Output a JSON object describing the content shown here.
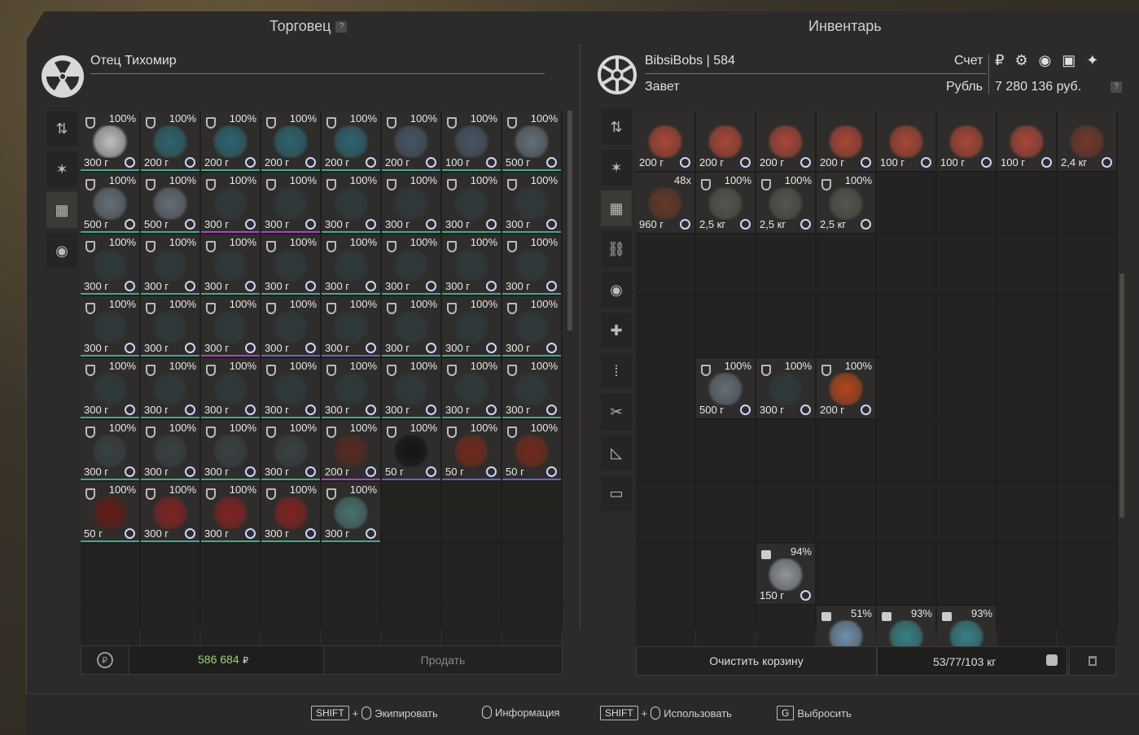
{
  "trader": {
    "title": "Торговец",
    "help": "?",
    "name": "Отец Тихомир",
    "total": "586 684",
    "currency": "₽",
    "sell_label": "Продать",
    "items": [
      {
        "pct": "100%",
        "wt": "300 г",
        "color": "#d0d0d0",
        "line": "#4a8"
      },
      {
        "pct": "100%",
        "wt": "200 г",
        "color": "#2e6b78",
        "line": "#4a8"
      },
      {
        "pct": "100%",
        "wt": "200 г",
        "color": "#2e6b78",
        "line": "#4a8"
      },
      {
        "pct": "100%",
        "wt": "200 г",
        "color": "#2e6b78",
        "line": "#4a8"
      },
      {
        "pct": "100%",
        "wt": "200 г",
        "color": "#2e6b78",
        "line": "#4a8"
      },
      {
        "pct": "100%",
        "wt": "200 г",
        "color": "#4b5a6b",
        "line": "#4a8"
      },
      {
        "pct": "100%",
        "wt": "100 г",
        "color": "#4b5a6b",
        "line": "#4a8"
      },
      {
        "pct": "100%",
        "wt": "500 г",
        "color": "#6b7680",
        "line": "#4a8"
      },
      {
        "pct": "100%",
        "wt": "500 г",
        "color": "#6b7680",
        "line": "#4a8"
      },
      {
        "pct": "100%",
        "wt": "500 г",
        "color": "#6b7680",
        "line": "#4a8"
      },
      {
        "pct": "100%",
        "wt": "300 г",
        "color": "#2f3c40",
        "line": "#a4c"
      },
      {
        "pct": "100%",
        "wt": "300 г",
        "color": "#2f3c40",
        "line": "#a4c"
      },
      {
        "pct": "100%",
        "wt": "300 г",
        "color": "#2f3c40",
        "line": "#4a8"
      },
      {
        "pct": "100%",
        "wt": "300 г",
        "color": "#2f3c40",
        "line": "#4a8"
      },
      {
        "pct": "100%",
        "wt": "300 г",
        "color": "#2f3c40",
        "line": "#4a8"
      },
      {
        "pct": "100%",
        "wt": "300 г",
        "color": "#2f3c40",
        "line": "#4a8"
      },
      {
        "pct": "100%",
        "wt": "300 г",
        "color": "#2f3c40",
        "line": "#4a8"
      },
      {
        "pct": "100%",
        "wt": "300 г",
        "color": "#2f3c40",
        "line": "#4a8"
      },
      {
        "pct": "100%",
        "wt": "300 г",
        "color": "#2f3c40",
        "line": "#4a8"
      },
      {
        "pct": "100%",
        "wt": "300 г",
        "color": "#2f3c40",
        "line": "#4a8"
      },
      {
        "pct": "100%",
        "wt": "300 г",
        "color": "#2f3c40",
        "line": "#4a8"
      },
      {
        "pct": "100%",
        "wt": "300 г",
        "color": "#2f3c40",
        "line": "#4a8"
      },
      {
        "pct": "100%",
        "wt": "300 г",
        "color": "#2f3c40",
        "line": "#4a8"
      },
      {
        "pct": "100%",
        "wt": "300 г",
        "color": "#2f3c40",
        "line": "#4a8"
      },
      {
        "pct": "100%",
        "wt": "300 г",
        "color": "#2f3c40",
        "line": "#4a8"
      },
      {
        "pct": "100%",
        "wt": "300 г",
        "color": "#2f3c40",
        "line": "#4a8"
      },
      {
        "pct": "100%",
        "wt": "300 г",
        "color": "#2f3c40",
        "line": "#a4c"
      },
      {
        "pct": "100%",
        "wt": "300 г",
        "color": "#2f3c40",
        "line": "#66c"
      },
      {
        "pct": "100%",
        "wt": "300 г",
        "color": "#2f3c40",
        "line": "#66c"
      },
      {
        "pct": "100%",
        "wt": "300 г",
        "color": "#2f3c40",
        "line": "#4a8"
      },
      {
        "pct": "100%",
        "wt": "300 г",
        "color": "#2f3c40",
        "line": "#4a8"
      },
      {
        "pct": "100%",
        "wt": "300 г",
        "color": "#2f3c40",
        "line": "#4a8"
      },
      {
        "pct": "100%",
        "wt": "300 г",
        "color": "#2f3c40",
        "line": "#4a8"
      },
      {
        "pct": "100%",
        "wt": "300 г",
        "color": "#2f3c40",
        "line": "#4a8"
      },
      {
        "pct": "100%",
        "wt": "300 г",
        "color": "#2f3c40",
        "line": "#4a8"
      },
      {
        "pct": "100%",
        "wt": "300 г",
        "color": "#2f3c40",
        "line": "#4a8"
      },
      {
        "pct": "100%",
        "wt": "300 г",
        "color": "#2f3c40",
        "line": "#4a8"
      },
      {
        "pct": "100%",
        "wt": "300 г",
        "color": "#2f3c40",
        "line": "#4a8"
      },
      {
        "pct": "100%",
        "wt": "300 г",
        "color": "#2f3c40",
        "line": "#4a8"
      },
      {
        "pct": "100%",
        "wt": "300 г",
        "color": "#2f3c40",
        "line": "#4a8"
      },
      {
        "pct": "100%",
        "wt": "300 г",
        "color": "#3a4448",
        "line": "#4a8"
      },
      {
        "pct": "100%",
        "wt": "300 г",
        "color": "#3a4448",
        "line": "#4a8"
      },
      {
        "pct": "100%",
        "wt": "300 г",
        "color": "#3a4448",
        "line": "#4a8"
      },
      {
        "pct": "100%",
        "wt": "300 г",
        "color": "#3a4448",
        "line": "#4a8"
      },
      {
        "pct": "100%",
        "wt": "200 г",
        "color": "#5a2a22",
        "line": "#a4c"
      },
      {
        "pct": "100%",
        "wt": "50 г",
        "color": "#111111",
        "line": "#66c"
      },
      {
        "pct": "100%",
        "wt": "50 г",
        "color": "#7a2a1a",
        "line": "#66c"
      },
      {
        "pct": "100%",
        "wt": "50 г",
        "color": "#7a2a1a",
        "line": "#66c"
      },
      {
        "pct": "100%",
        "wt": "50 г",
        "color": "#6a1a14",
        "line": "#4a8"
      },
      {
        "pct": "100%",
        "wt": "300 г",
        "color": "#8a2222",
        "line": "#4a8"
      },
      {
        "pct": "100%",
        "wt": "300 г",
        "color": "#8a2222",
        "line": "#4a8"
      },
      {
        "pct": "100%",
        "wt": "300 г",
        "color": "#8a2222",
        "line": "#4a8"
      },
      {
        "pct": "100%",
        "wt": "300 г",
        "color": "#4a7a78",
        "line": "#4a8"
      }
    ]
  },
  "player": {
    "title": "Инвентарь",
    "name": "BibsiBobs | 584",
    "faction": "Завет",
    "account_label": "Счет",
    "currency_label": "Рубль",
    "money": "7 280 136 руб.",
    "help": "?",
    "account_icons": "₽ ⚙ ◉ ▣ ✦",
    "clear_label": "Очистить корзину",
    "weight": "53/77/103 кг",
    "items": [
      {
        "row": 0,
        "col": 0,
        "wt": "200 г",
        "pct": "",
        "color": "#b84a3a"
      },
      {
        "row": 0,
        "col": 1,
        "wt": "200 г",
        "pct": "",
        "color": "#b84a3a"
      },
      {
        "row": 0,
        "col": 2,
        "wt": "200 г",
        "pct": "",
        "color": "#b84a3a"
      },
      {
        "row": 0,
        "col": 3,
        "wt": "200 г",
        "pct": "",
        "color": "#b84a3a"
      },
      {
        "row": 0,
        "col": 4,
        "wt": "100 г",
        "pct": "",
        "color": "#b84a3a"
      },
      {
        "row": 0,
        "col": 5,
        "wt": "100 г",
        "pct": "",
        "color": "#b84a3a"
      },
      {
        "row": 0,
        "col": 6,
        "wt": "100 г",
        "pct": "",
        "color": "#b84a3a"
      },
      {
        "row": 0,
        "col": 7,
        "wt": "2,4 кг",
        "pct": "",
        "color": "#7a3a2a"
      },
      {
        "row": 1,
        "col": 0,
        "wt": "960 г",
        "pct": "48x",
        "color": "#6a3a2a"
      },
      {
        "row": 1,
        "col": 1,
        "wt": "2,5 кг",
        "pct": "100%",
        "color": "#5a5a52"
      },
      {
        "row": 1,
        "col": 2,
        "wt": "2,5 кг",
        "pct": "100%",
        "color": "#5a5a52"
      },
      {
        "row": 1,
        "col": 3,
        "wt": "2,5 кг",
        "pct": "100%",
        "color": "#5a5a52"
      },
      {
        "row": 4,
        "col": 1,
        "wt": "500 г",
        "pct": "100%",
        "color": "#6b7680"
      },
      {
        "row": 4,
        "col": 2,
        "wt": "300 г",
        "pct": "100%",
        "color": "#2f3c40"
      },
      {
        "row": 4,
        "col": 3,
        "wt": "200 г",
        "pct": "100%",
        "color": "#c04a1a"
      },
      {
        "row": 7,
        "col": 2,
        "wt": "150 г",
        "pct": "94%",
        "color": "#9aa0a8"
      },
      {
        "row": 8,
        "col": 3,
        "wt": "",
        "pct": "51%",
        "color": "#7a9ab8"
      },
      {
        "row": 8,
        "col": 4,
        "wt": "",
        "pct": "93%",
        "color": "#3a8a90"
      },
      {
        "row": 8,
        "col": 5,
        "wt": "",
        "pct": "93%",
        "color": "#3a8a90"
      }
    ]
  },
  "trader_tabs": [
    "sort-icon",
    "star-icon",
    "grid-icon",
    "artifact-icon"
  ],
  "player_tabs": [
    "sort-icon",
    "star-icon",
    "grid-icon",
    "link-icon",
    "artifact-icon",
    "medkit-icon",
    "ammo-icon",
    "tools-icon",
    "ruler-icon",
    "box-icon"
  ],
  "footer": {
    "equip_key": "SHIFT",
    "equip_label": "Экипировать",
    "info_label": "Информация",
    "use_key": "SHIFT",
    "use_label": "Использовать",
    "drop_key": "G",
    "drop_label": "Выбросить",
    "plus": "+"
  }
}
